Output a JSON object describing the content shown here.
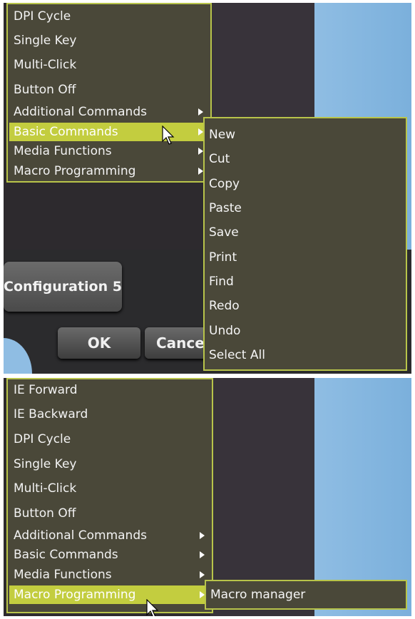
{
  "top_panel": {
    "context_menu": {
      "items": [
        {
          "label": "DPI Cycle",
          "has_submenu": false
        },
        {
          "label": "Single Key",
          "has_submenu": false
        },
        {
          "label": "Multi-Click",
          "has_submenu": false
        },
        {
          "label": "Button Off",
          "has_submenu": false
        },
        {
          "label": "Additional Commands",
          "has_submenu": true
        },
        {
          "label": "Basic Commands",
          "has_submenu": true,
          "highlighted": true
        },
        {
          "label": "Media Functions",
          "has_submenu": true
        },
        {
          "label": "Macro Programming",
          "has_submenu": true
        }
      ]
    },
    "submenu": {
      "items": [
        "New",
        "Cut",
        "Copy",
        "Paste",
        "Save",
        "Print",
        "Find",
        "Redo",
        "Undo",
        "Select All"
      ]
    },
    "config_button": "Configuration 5",
    "ok_button": "OK",
    "cancel_button": "Cance"
  },
  "bottom_panel": {
    "context_menu": {
      "items": [
        {
          "label": "IE Forward",
          "has_submenu": false
        },
        {
          "label": "IE Backward",
          "has_submenu": false
        },
        {
          "label": "DPI Cycle",
          "has_submenu": false
        },
        {
          "label": "Single Key",
          "has_submenu": false
        },
        {
          "label": "Multi-Click",
          "has_submenu": false
        },
        {
          "label": "Button Off",
          "has_submenu": false
        },
        {
          "label": "Additional Commands",
          "has_submenu": true
        },
        {
          "label": "Basic Commands",
          "has_submenu": true
        },
        {
          "label": "Media Functions",
          "has_submenu": true
        },
        {
          "label": "Macro Programming",
          "has_submenu": true,
          "highlighted": true
        }
      ]
    },
    "submenu": {
      "items": [
        "Macro manager"
      ]
    }
  },
  "colors": {
    "menu_bg": "#4a4839",
    "menu_border": "#b8c44a",
    "highlight": "#c3cd3f",
    "desktop_blue": "#8fbde3",
    "panel_dark": "#2d2a2e"
  }
}
